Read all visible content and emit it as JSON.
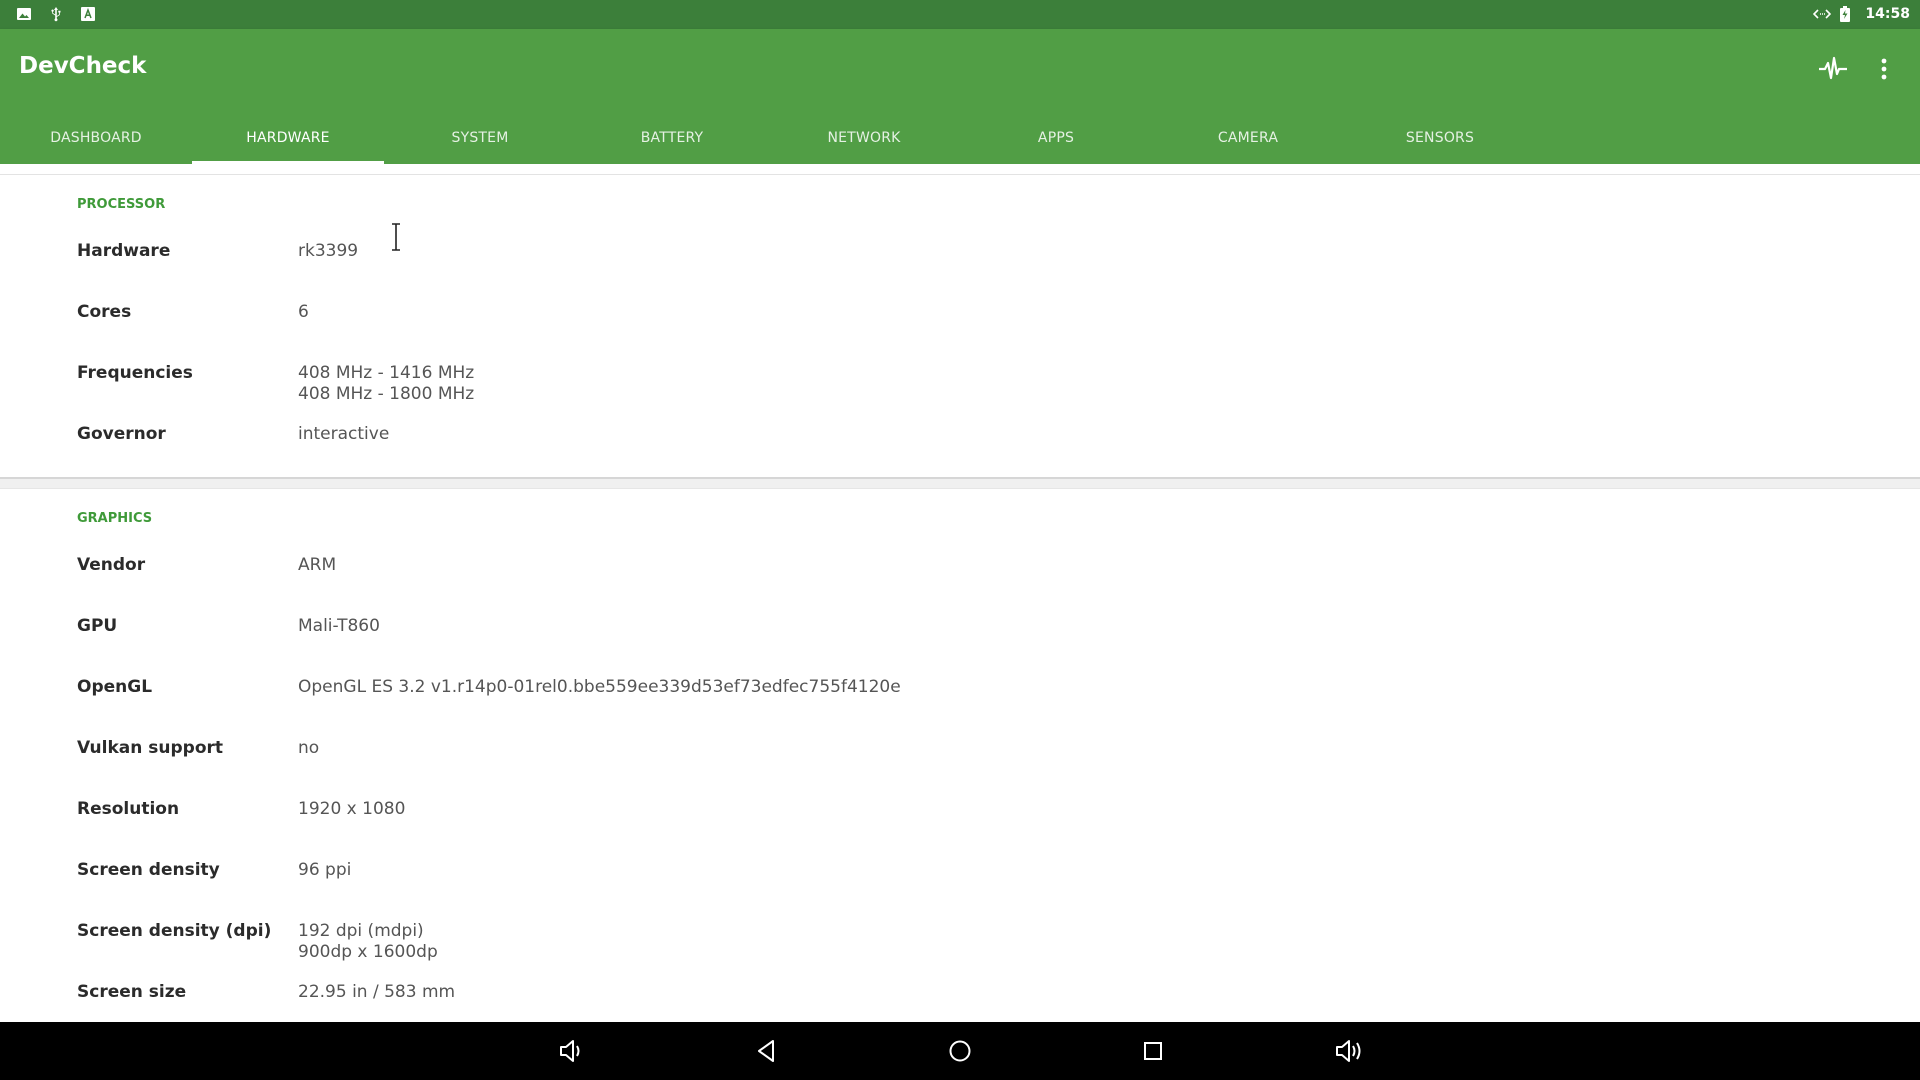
{
  "status_bar": {
    "left_icons": [
      "image-icon",
      "usb-icon",
      "font-icon"
    ],
    "right_icons": [
      "code-icon",
      "battery-icon"
    ],
    "time": "14:58"
  },
  "app": {
    "title": "DevCheck",
    "actions": [
      "activity-icon",
      "more-vert-icon"
    ]
  },
  "tabs": [
    {
      "label": "DASHBOARD",
      "active": false
    },
    {
      "label": "HARDWARE",
      "active": true
    },
    {
      "label": "SYSTEM",
      "active": false
    },
    {
      "label": "BATTERY",
      "active": false
    },
    {
      "label": "NETWORK",
      "active": false
    },
    {
      "label": "APPS",
      "active": false
    },
    {
      "label": "CAMERA",
      "active": false
    },
    {
      "label": "SENSORS",
      "active": false
    }
  ],
  "processor": {
    "title": "PROCESSOR",
    "rows": [
      {
        "label": "Hardware",
        "value": "rk3399"
      },
      {
        "label": "Cores",
        "value": "6"
      },
      {
        "label": "Frequencies",
        "value": "408 MHz - 1416 MHz",
        "value2": "408 MHz - 1800 MHz"
      },
      {
        "label": "Governor",
        "value": "interactive"
      }
    ]
  },
  "graphics": {
    "title": "GRAPHICS",
    "rows": [
      {
        "label": "Vendor",
        "value": "ARM"
      },
      {
        "label": "GPU",
        "value": "Mali-T860"
      },
      {
        "label": "OpenGL",
        "value": "OpenGL ES 3.2 v1.r14p0-01rel0.bbe559ee339d53ef73edfec755f4120e"
      },
      {
        "label": "Vulkan support",
        "value": "no"
      },
      {
        "label": "Resolution",
        "value": "1920 x 1080"
      },
      {
        "label": "Screen density",
        "value": "96 ppi"
      },
      {
        "label": "Screen density (dpi)",
        "value": "192 dpi (mdpi)",
        "value2": "900dp x 1600dp"
      },
      {
        "label": "Screen size",
        "value": "22.95 in / 583 mm"
      }
    ]
  },
  "nav_bar": [
    "volume-down-icon",
    "back-icon",
    "home-icon",
    "recents-icon",
    "volume-up-icon"
  ],
  "colors": {
    "status_bar": "#3c7f3a",
    "app_bar": "#519e45",
    "section_title": "#3f9a39"
  }
}
